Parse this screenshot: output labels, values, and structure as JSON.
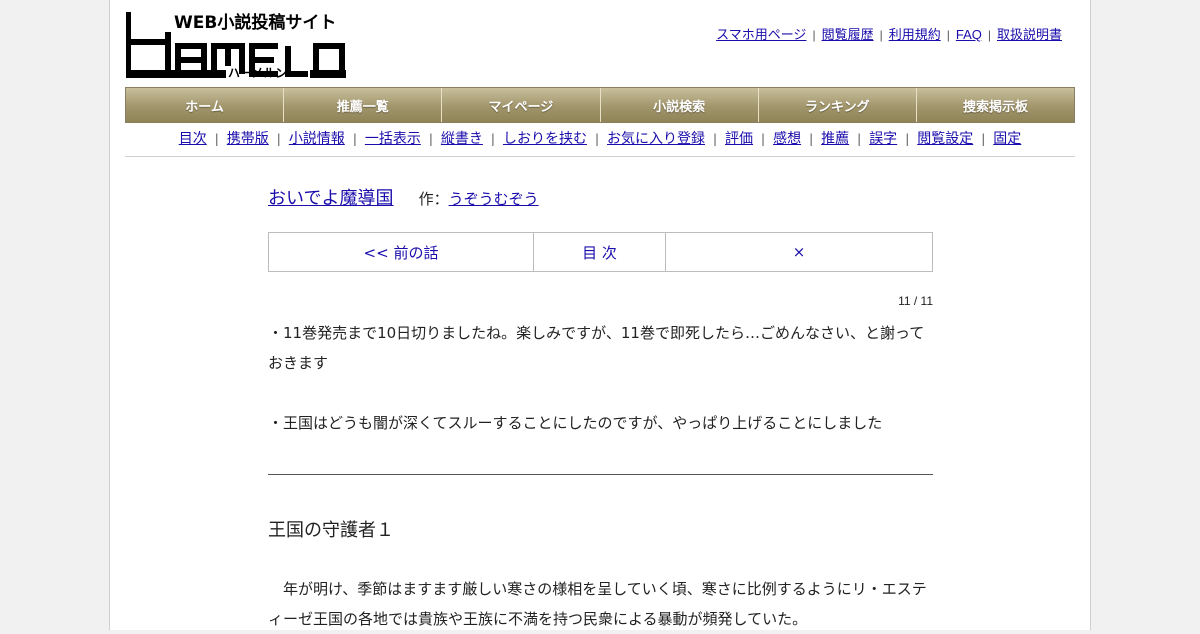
{
  "logo": {
    "tagline": "WEB小説投稿サイト",
    "wordmark": "HAMELN",
    "reading": "ハーメルン"
  },
  "top_links": [
    "スマホ用ページ",
    "閲覧履歴",
    "利用規約",
    "FAQ",
    "取扱説明書"
  ],
  "main_nav": [
    "ホーム",
    "推薦一覧",
    "マイページ",
    "小説検索",
    "ランキング",
    "捜索掲示板"
  ],
  "sub_nav": [
    "目次",
    "携帯版",
    "小説情報",
    "一括表示",
    "縦書き",
    "しおりを挟む",
    "お気に入り登録",
    "評価",
    "感想",
    "推薦",
    "誤字",
    "閲覧設定",
    "固定"
  ],
  "novel": {
    "title": "おいでよ魔導国",
    "author_prefix": "作：",
    "author": "うぞうむぞう"
  },
  "episode_nav": {
    "prev": "<< 前の話",
    "toc": "目 次",
    "next": "×"
  },
  "page_counter": "11 / 11",
  "preface": [
    "・11巻発売まで10日切りましたね。楽しみですが、11巻で即死したら…ごめんなさい、と謝っておきます",
    "・王国はどうも闇が深くてスルーすることにしたのですが、やっぱり上げることにしました"
  ],
  "chapter_title": "王国の守護者１",
  "body": "　年が明け、季節はますます厳しい寒さの様相を呈していく頃、寒さに比例するようにリ・エスティーゼ王国の各地では貴族や王族に不満を持つ民衆による暴動が頻発していた。",
  "colors": {
    "link": "#1a0dab",
    "nav_gold": "#a1956b"
  }
}
